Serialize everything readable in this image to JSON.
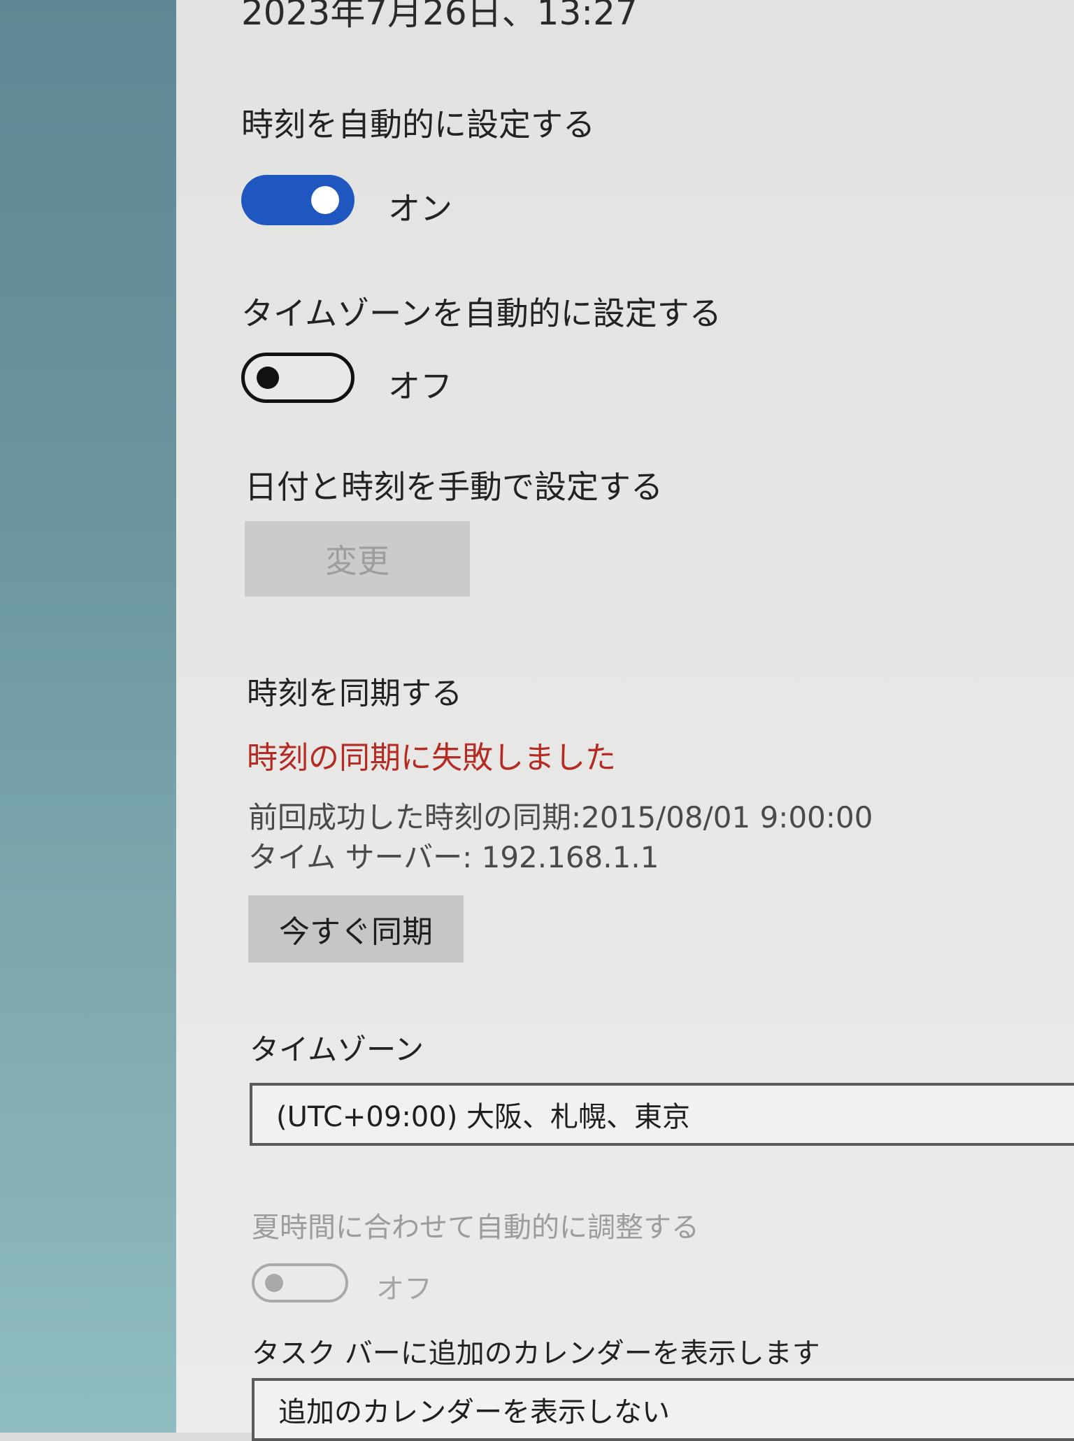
{
  "current_datetime": "2023年7月26日、13:27",
  "auto_time": {
    "label": "時刻を自動的に設定する",
    "state_label": "オン",
    "on": true
  },
  "auto_timezone": {
    "label": "タイムゾーンを自動的に設定する",
    "state_label": "オフ",
    "on": false
  },
  "manual": {
    "label": "日付と時刻を手動で設定する",
    "button_label": "変更",
    "button_enabled": false
  },
  "sync": {
    "label": "時刻を同期する",
    "error_text": "時刻の同期に失敗しました",
    "last_success": "前回成功した時刻の同期:2015/08/01 9:00:00",
    "time_server": "タイム サーバー: 192.168.1.1",
    "button_label": "今すぐ同期"
  },
  "timezone": {
    "label": "タイムゾーン",
    "value": "(UTC+09:00) 大阪、札幌、東京"
  },
  "dst": {
    "label": "夏時間に合わせて自動的に調整する",
    "state_label": "オフ",
    "on": false,
    "enabled": false
  },
  "calendar": {
    "label": "タスク バーに追加のカレンダーを表示します",
    "value": "追加のカレンダーを表示しない"
  },
  "colors": {
    "toggle_on": "#1f56c0",
    "error": "#b42b24"
  }
}
